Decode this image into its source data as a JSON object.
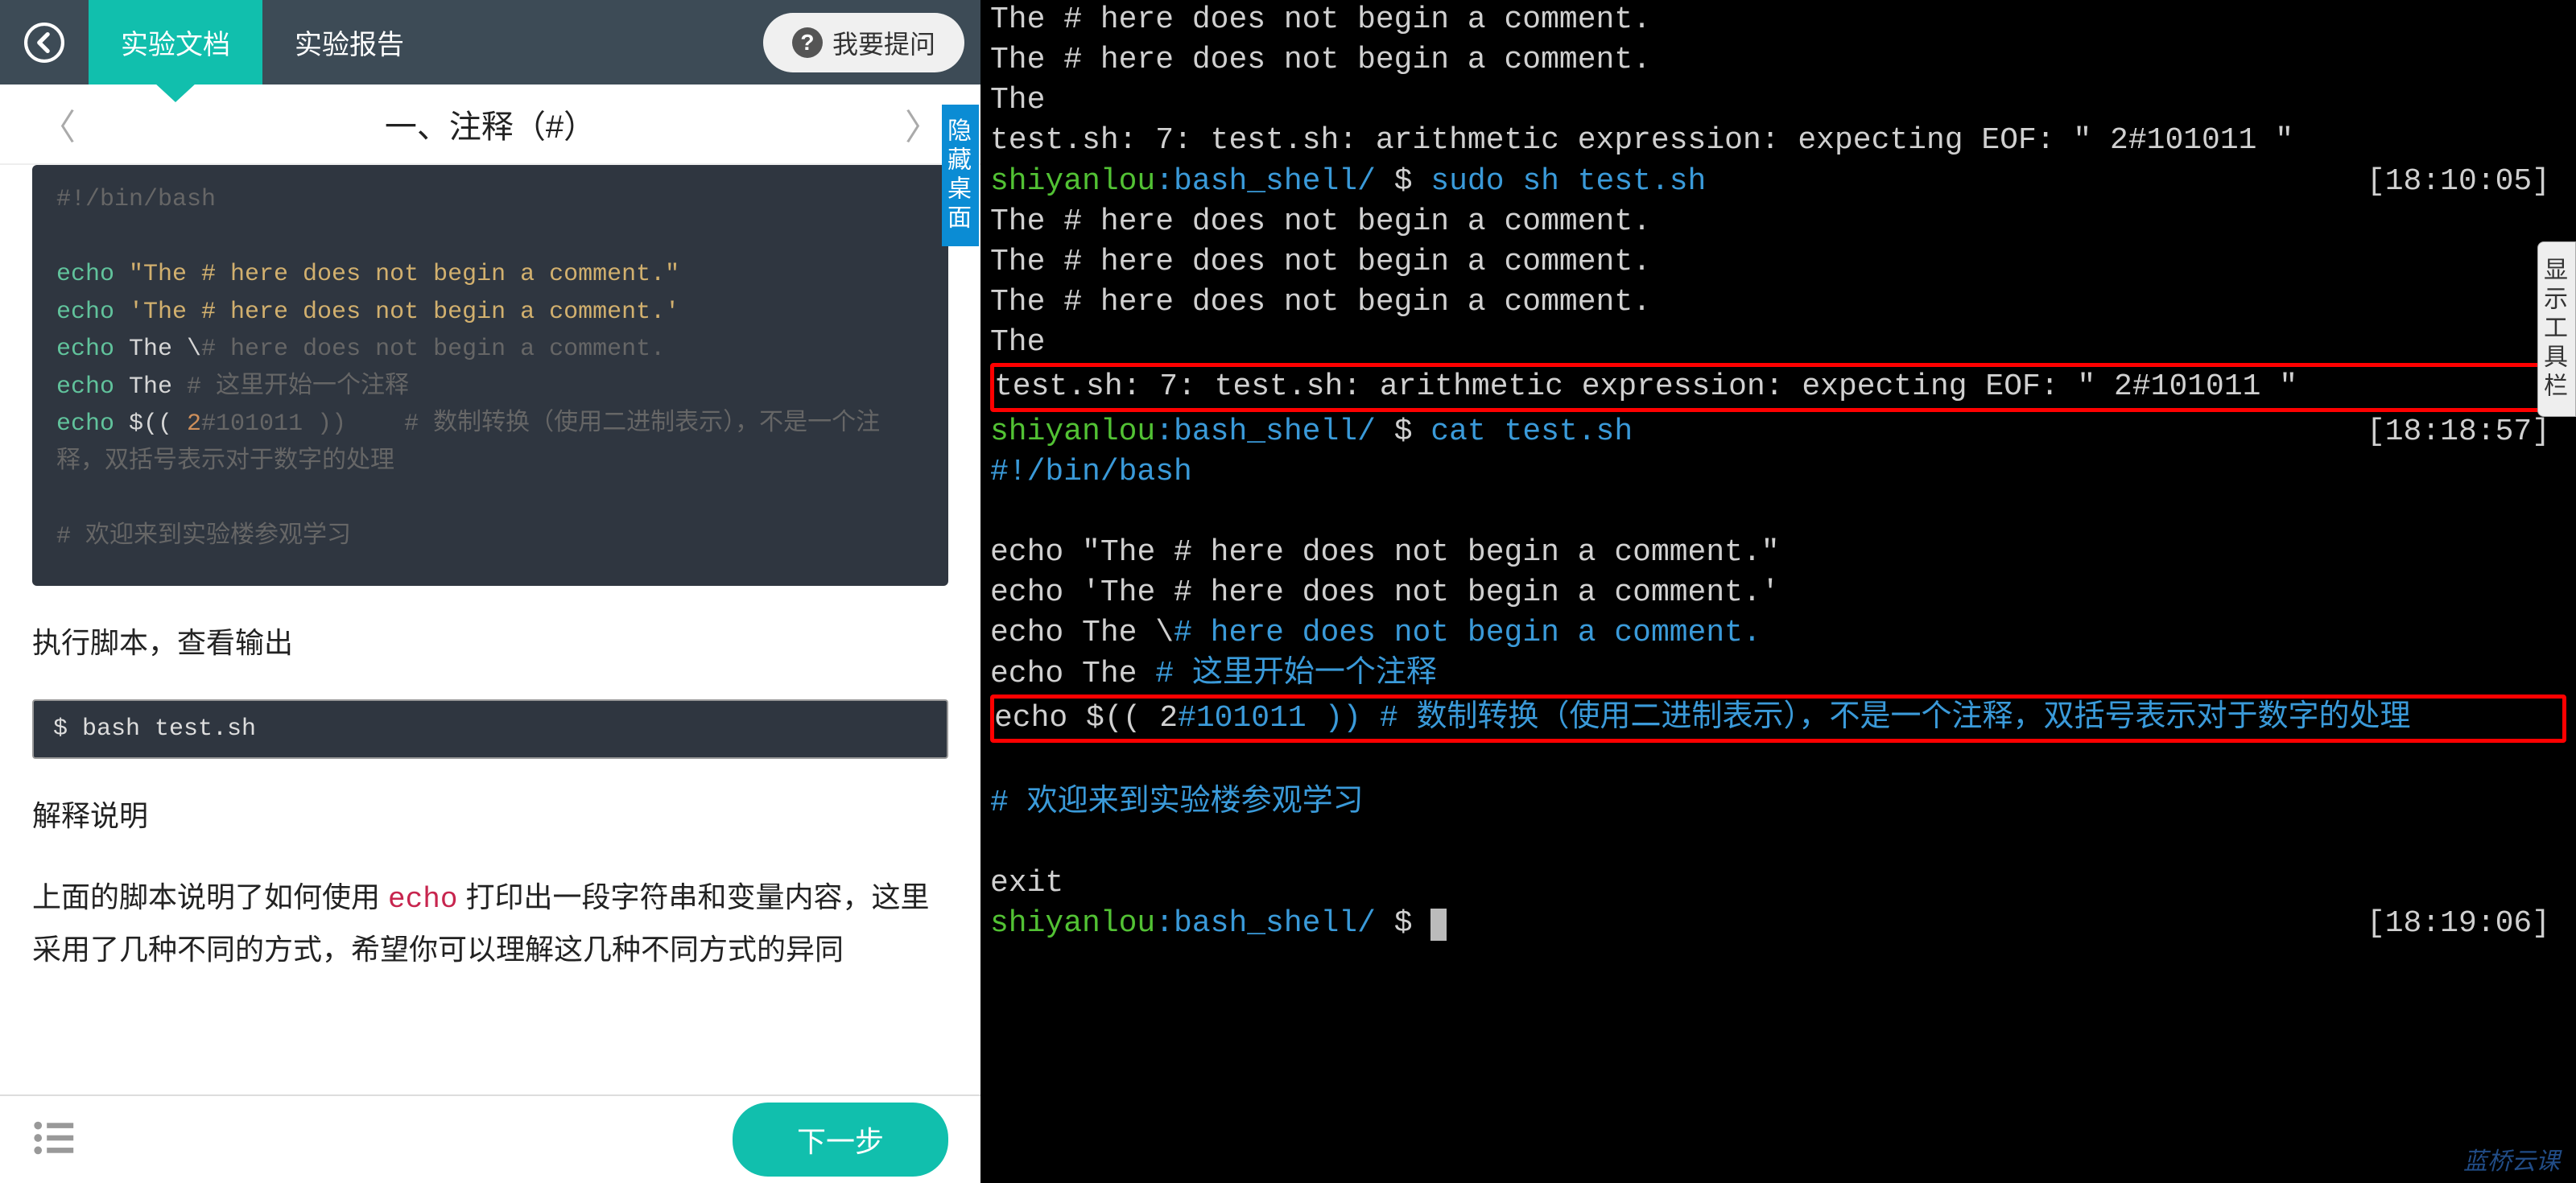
{
  "header": {
    "tab_doc": "实验文档",
    "tab_report": "实验报告",
    "ask": "我要提问"
  },
  "section": {
    "title": "一、注释（#）"
  },
  "code": {
    "l1": "#!/bin/bash",
    "l2_kw": "echo",
    "l2_str": " \"The # here does not begin a comment.\"",
    "l3_kw": "echo",
    "l3_str": " 'The # here does not begin a comment.'",
    "l4_kw": "echo",
    "l4_txt": " The \\",
    "l4_cmt": "# here does not begin a comment.",
    "l5_kw": "echo",
    "l5_txt": " The ",
    "l5_cmt": "# 这里开始一个注释",
    "l6_kw": "echo",
    "l6_txt": " $(( ",
    "l6_num": "2",
    "l6_cmt1": "#101011 ))    ",
    "l6_cmt2": "# 数制转换（使用二进制表示），不是一个注释，双括号表示对于数字的处理",
    "l7": "# 欢迎来到实验楼参观学习"
  },
  "para1": "执行脚本，查看输出",
  "cmd1": "$ bash test.sh",
  "para2": "解释说明",
  "para3_a": "上面的脚本说明了如何使用 ",
  "para3_code": "echo",
  "para3_b": " 打印出一段字符串和变量内容，这里采用了几种不同的方式，希望你可以理解这几种不同方式的异同",
  "footer": {
    "next": "下一步"
  },
  "hide_tab": "隐藏桌面",
  "show_tool": "显示工具栏",
  "terminal": {
    "l1": "The # here does not begin a comment.",
    "l2": "The # here does not begin a comment.",
    "l3": "The",
    "l4": "test.sh: 7: test.sh: arithmetic expression: expecting EOF: \" 2#101011 \"",
    "p1_user": "shiyanlou",
    "p1_path": ":bash_shell/ ",
    "p1_dollar": "$ ",
    "p1_cmd": "sudo sh test.sh",
    "p1_time": "[18:10:05]",
    "l5": "The # here does not begin a comment.",
    "l6": "The # here does not begin a comment.",
    "l7": "The # here does not begin a comment.",
    "l8": "The",
    "l9": "test.sh: 7: test.sh: arithmetic expression: expecting EOF: \" 2#101011 \"",
    "p2_user": "shiyanlou",
    "p2_path": ":bash_shell/ ",
    "p2_dollar": "$ ",
    "p2_cmd": "cat test.sh",
    "p2_time": "[18:18:57]",
    "c1": "#!/bin/bash",
    "c2a": "echo ",
    "c2b": "\"The # here does not begin a comment.\"",
    "c3a": "echo ",
    "c3b": "'The # here does not begin a comment.'",
    "c4a": "echo The \\",
    "c4b": "# here does not begin a comment.",
    "c5a": "echo The ",
    "c5b": "# 这里开始一个注释",
    "c6a": "echo $(( 2",
    "c6b": "#101011 )) # 数制转换（使用二进制表示），不是一个注释，双括号表示对于数字的处理",
    "c7": "# 欢迎来到实验楼参观学习",
    "exit": "exit",
    "p3_user": "shiyanlou",
    "p3_path": ":bash_shell/ ",
    "p3_dollar": "$ ",
    "p3_time": "[18:19:06]"
  },
  "watermark": "蓝桥云课"
}
